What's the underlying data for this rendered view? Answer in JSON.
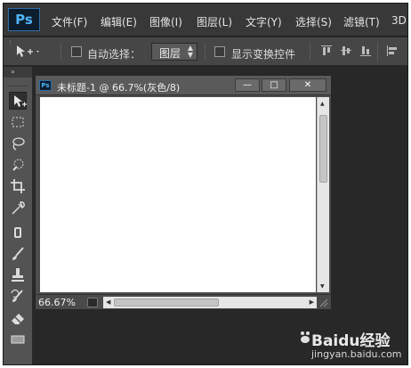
{
  "app": {
    "logo": "Ps"
  },
  "menu": [
    {
      "label": "文件(F)"
    },
    {
      "label": "编辑(E)"
    },
    {
      "label": "图像(I)"
    },
    {
      "label": "图层(L)"
    },
    {
      "label": "文字(Y)"
    },
    {
      "label": "选择(S)"
    },
    {
      "label": "滤镜(T)"
    },
    {
      "label": "3D"
    }
  ],
  "options": {
    "auto_select_label": "自动选择：",
    "auto_select_checked": false,
    "auto_select_target": "图层",
    "show_transform_label": "显示变换控件",
    "show_transform_checked": false
  },
  "document": {
    "title": "未标题-1 @ 66.7%(灰色/8)",
    "zoom": "66.67%",
    "canvas_color": "#ffffff",
    "buttons": {
      "minimize": "—",
      "maximize": "□",
      "close": "✕"
    }
  },
  "tools": [
    {
      "icon": "move-tool-icon",
      "active": true
    },
    {
      "icon": "marquee-tool-icon"
    },
    {
      "icon": "lasso-tool-icon"
    },
    {
      "icon": "quick-selection-tool-icon"
    },
    {
      "icon": "crop-tool-icon"
    },
    {
      "icon": "eyedropper-tool-icon"
    },
    {
      "icon": "spot-healing-tool-icon"
    },
    {
      "icon": "brush-tool-icon"
    },
    {
      "icon": "clone-stamp-tool-icon"
    },
    {
      "icon": "history-brush-tool-icon"
    },
    {
      "icon": "eraser-tool-icon"
    }
  ],
  "watermark": {
    "brand": "Baidu经验",
    "url": "jingyan.baidu.com"
  },
  "colors": {
    "menubar": "#383838",
    "optionsbar": "#464646",
    "workspace": "#282828",
    "ps_blue": "#4fb4f5"
  }
}
